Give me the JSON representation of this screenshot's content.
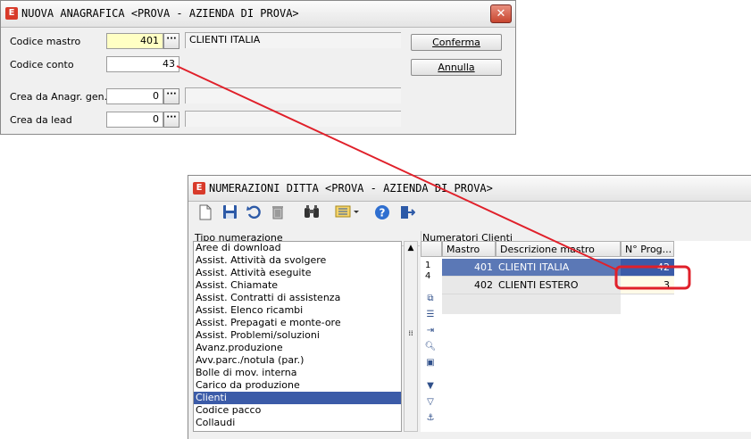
{
  "dialog": {
    "title": "NUOVA ANAGRAFICA <PROVA - AZIENDA DI PROVA>",
    "close_glyph": "✕",
    "logo_text": "E",
    "fields": [
      {
        "label": "Codice mastro",
        "value": "401",
        "desc": "CLIENTI ITALIA"
      },
      {
        "label": "Codice conto",
        "value": "43",
        "desc": ""
      },
      {
        "label": "Crea da Anagr. gen.",
        "value": "0",
        "desc": ""
      },
      {
        "label": "Crea da lead",
        "value": "0",
        "desc": ""
      }
    ],
    "lookup_glyph": "···",
    "confirm_label": "Conferma",
    "cancel_label": "Annulla"
  },
  "numbering": {
    "title": "NUMERAZIONI DITTA <PROVA - AZIENDA DI PROVA>",
    "logo_text": "E",
    "toolbar_icons": [
      "new-document-icon",
      "save-icon",
      "undo-icon",
      "delete-icon",
      "binoculars-icon",
      "list-view-icon",
      "help-icon",
      "exit-icon"
    ],
    "left_header": "Tipo numerazione",
    "right_header": "Numeratori Clienti",
    "types": [
      "Aree di download",
      "Assist. Attività da svolgere",
      "Assist. Attività eseguite",
      "Assist. Chiamate",
      "Assist. Contratti di assistenza",
      "Assist. Elenco ricambi",
      "Assist. Prepagati e monte-ore",
      "Assist. Problemi/soluzioni",
      "Avanz.produzione",
      "Avv.parc./notula (par.)",
      "Bolle di mov. interna",
      "Carico da produzione",
      "Clienti",
      "Codice pacco",
      "Collaudi"
    ],
    "selected_type": "Clienti",
    "grid": {
      "columns": [
        "Mastro",
        "Descrizione mastro",
        "N° Prog..."
      ],
      "rows": [
        {
          "mastro": "401",
          "descrizione": "CLIENTI ITALIA",
          "prog": "42"
        },
        {
          "mastro": "402",
          "descrizione": "CLIENTI ESTERO",
          "prog": "3"
        }
      ],
      "row_indicator_top": "1",
      "row_indicator_bottom": "4"
    }
  },
  "colors": {
    "highlight_red": "#e0202a",
    "selection_blue": "#3b5ba8",
    "yellow_field": "#ffffc4"
  }
}
